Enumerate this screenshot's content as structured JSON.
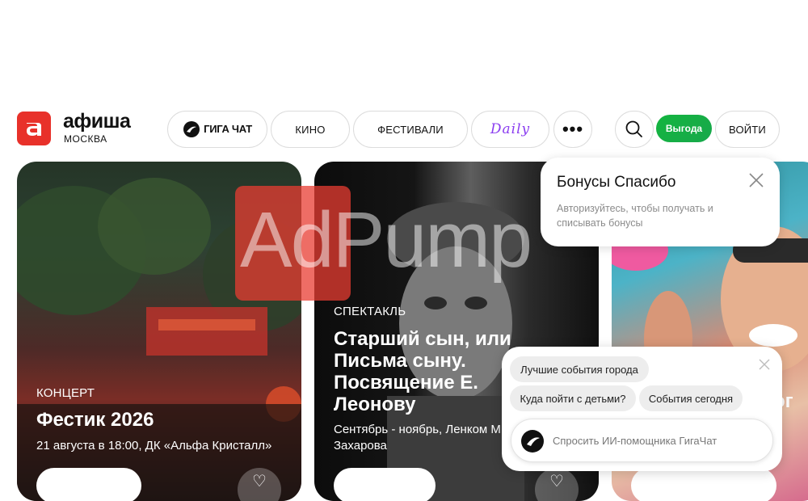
{
  "header": {
    "brand": "афиша",
    "city": "МОСКВА",
    "nav": {
      "gigachat_label": "ГИГА ЧАТ",
      "kino": "КИНО",
      "festivals": "ФЕСТИВАЛИ",
      "daily": "Daily",
      "more": "•••"
    },
    "benefit_label": "Выгода",
    "login_label": "ВОЙТИ"
  },
  "cards": [
    {
      "category": "КОНЦЕРТ",
      "title": "Фестик 2026",
      "subtitle": "21 августа в 18:00, ДК «Альфа Кристалл»"
    },
    {
      "category": "СПЕКТАКЛЬ",
      "title_lines": [
        "Старший сын, или",
        "Письма сыну.",
        "Посвящение Е.",
        "Леонову"
      ],
      "subtitle_lines": [
        "Сентябрь - ноябрь, Ленком М",
        "Захарова"
      ]
    },
    {
      "title_fragment": "ог"
    }
  ],
  "watermark": "AdPump",
  "bonus_popup": {
    "title": "Бонусы Спасибо",
    "text": "Авторизуйтесь, чтобы получать и списывать бонусы"
  },
  "giga_popup": {
    "chips": [
      "Лучшие события города",
      "Куда пойти с детьми?",
      "События сегодня"
    ],
    "ask_placeholder": "Спросить ИИ-помощника ГигаЧат"
  },
  "colors": {
    "brand_red": "#e8312a",
    "benefit_green": "#14b53f",
    "daily_purple": "#8a3cf0"
  },
  "icons": [
    "afisha-logo-icon",
    "gigachat-logo-icon",
    "search-icon",
    "close-icon",
    "heart-icon",
    "sber-icon"
  ]
}
